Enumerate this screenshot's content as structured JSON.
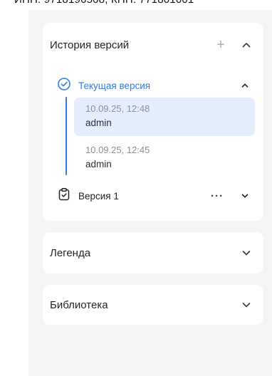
{
  "top_strip": {
    "text": "ИНН: 9718196508, КПП: 771801001"
  },
  "history": {
    "title": "История версий",
    "current": {
      "label": "Текущая версия",
      "entries": [
        {
          "date": "10.09.25, 12:48",
          "user": "admin",
          "selected": true
        },
        {
          "date": "10.09.25, 12:45",
          "user": "admin",
          "selected": false
        }
      ]
    },
    "version1": {
      "label": "Версия 1",
      "menu": "···"
    }
  },
  "legend": {
    "title": "Легенда"
  },
  "library": {
    "title": "Библиотека"
  },
  "colors": {
    "accent": "#2f7de1",
    "selected_bg": "#e5eefc",
    "panel_bg": "#f4f5f7"
  },
  "icons": [
    "plus-icon",
    "chevron-up-icon",
    "check-circle-icon",
    "clipboard-check-icon",
    "more-horizontal-icon",
    "chevron-down-icon"
  ]
}
